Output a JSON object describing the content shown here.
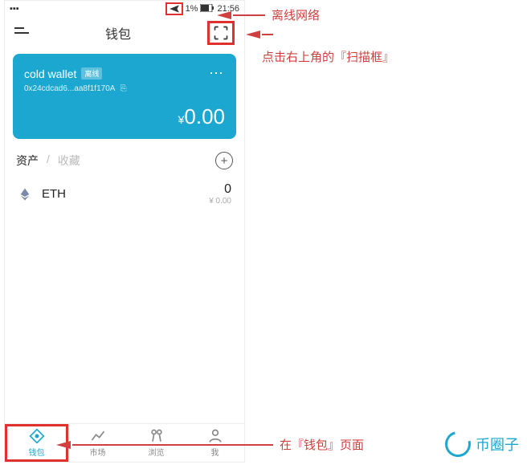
{
  "statusbar": {
    "battery_pct": "1%",
    "time": "21:56"
  },
  "header": {
    "title": "钱包"
  },
  "card": {
    "wallet_name": "cold wallet",
    "offline_badge": "离线",
    "address": "0x24cdcad6...aa8f1f170A",
    "currency_symbol": "¥",
    "balance": "0.00"
  },
  "section": {
    "tab_assets": "资产",
    "tab_favorites": "收藏",
    "divider": "/"
  },
  "assets": [
    {
      "symbol": "ETH",
      "amount": "0",
      "value": "¥ 0.00"
    }
  ],
  "nav": {
    "wallet": "钱包",
    "market": "市场",
    "browse": "浏览",
    "me": "我"
  },
  "annotations": {
    "offline_network": "离线网络",
    "scan_hint": "点击右上角的『扫描框』",
    "wallet_page": "在『钱包』页面"
  },
  "watermark": "币圈子"
}
